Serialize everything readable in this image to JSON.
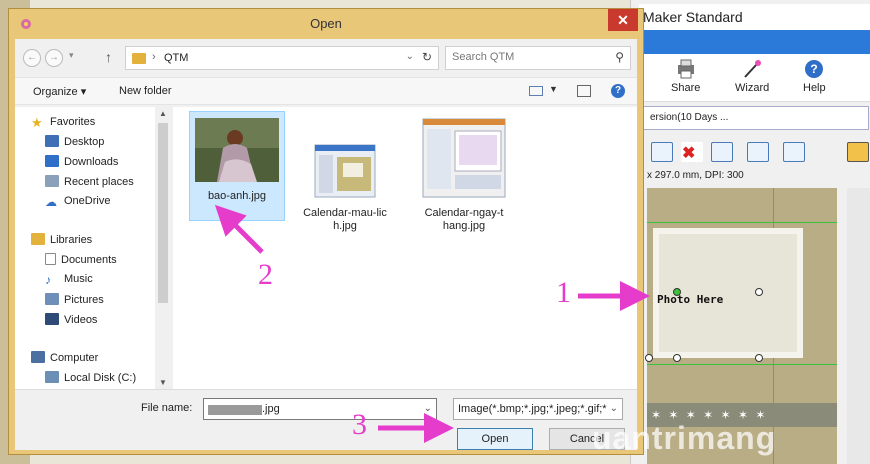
{
  "dialog": {
    "title": "Open",
    "close_label": "✕",
    "address": {
      "crumb": "QTM",
      "search_placeholder": "Search QTM"
    },
    "command_bar": {
      "organize_label": "Organize ▾",
      "new_folder_label": "New folder"
    },
    "nav": {
      "favorites_label": "Favorites",
      "favorites": [
        "Desktop",
        "Downloads",
        "Recent places",
        "OneDrive"
      ],
      "libraries_label": "Libraries",
      "libraries": [
        "Documents",
        "Music",
        "Pictures",
        "Videos"
      ],
      "computer_label": "Computer",
      "computer_items": [
        "Local Disk (C:)"
      ]
    },
    "files": [
      {
        "name": "bao-anh.jpg",
        "display": "bao-anh.jpg"
      },
      {
        "name_line1": "Calendar-mau-lic",
        "name_line2": "h.jpg"
      },
      {
        "name_line1": "Calendar-ngay-t",
        "name_line2": "hang.jpg"
      }
    ],
    "file_name_label": "File name:",
    "file_name_value": ".jpg",
    "file_type_value": "Image(*.bmp;*.jpg;*.jpeg;*.gif;*",
    "open_label": "Open",
    "cancel_label": "Cancel"
  },
  "background_app": {
    "title": "Maker Standard",
    "share_label": "Share",
    "wizard_label": "Wizard",
    "help_label": "Help",
    "version_text": "ersion(10 Days ...",
    "dims_text": "x 297.0 mm, DPI: 300",
    "photo_placeholder": "Photo Here"
  },
  "annotations": {
    "n1": "1",
    "n2": "2",
    "n3": "3",
    "color": "#e63ccc"
  },
  "watermark": "uantrimang"
}
